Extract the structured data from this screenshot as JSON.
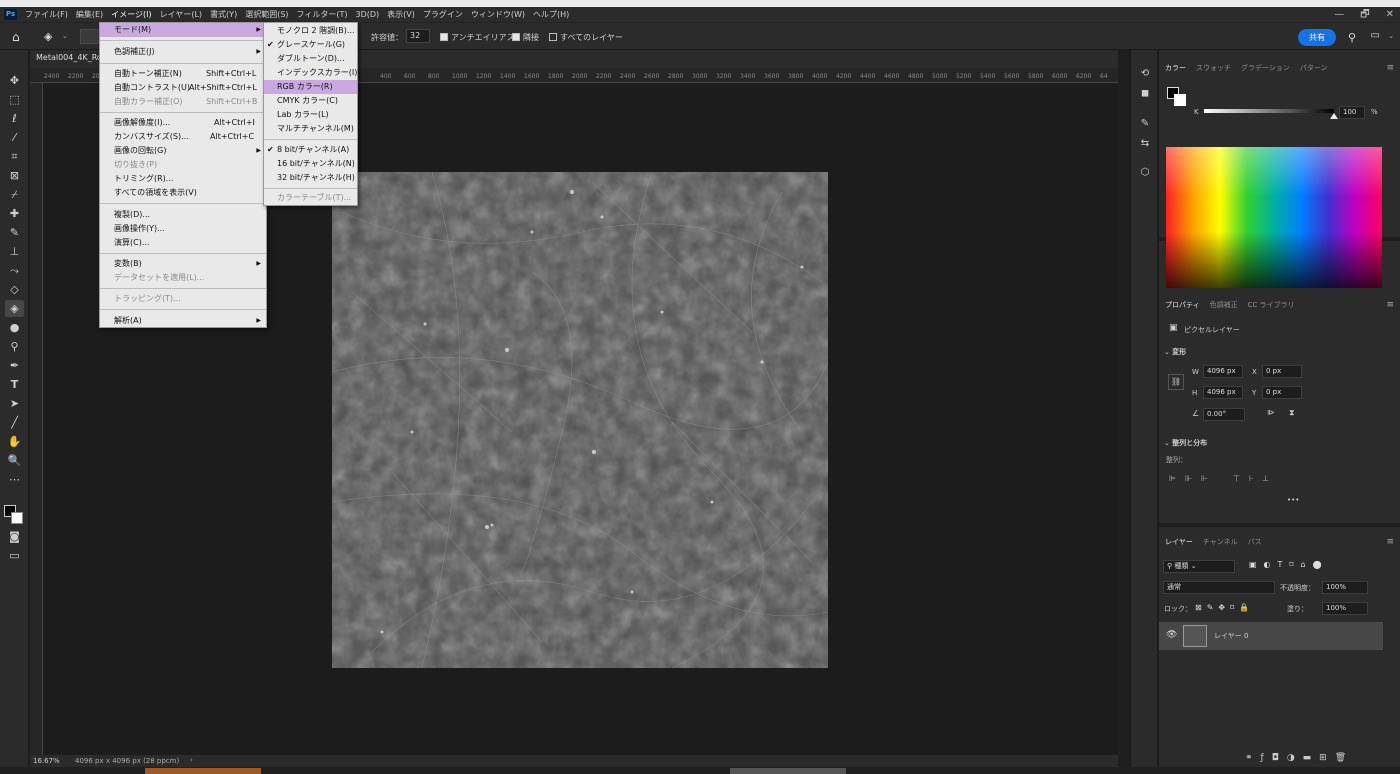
{
  "app": {
    "logo": "Ps"
  },
  "menubar": {
    "items": [
      "ファイル(F)",
      "編集(E)",
      "イメージ(I)",
      "レイヤー(L)",
      "書式(Y)",
      "選択範囲(S)",
      "フィルター(T)",
      "3D(D)",
      "表示(V)",
      "プラグイン",
      "ウィンドウ(W)",
      "ヘルプ(H)"
    ],
    "window_controls": [
      "—",
      "🗗",
      "✕"
    ]
  },
  "options": {
    "tolerance_label": "許容値：",
    "tolerance_value": "32",
    "antialias_label": "アンチエイリアス",
    "contiguous_label": "隣接",
    "all_layers_label": "すべてのレイヤー",
    "share_label": "共有"
  },
  "document": {
    "tab_label": "Metal004_4K_Ro",
    "ruler_ticks": [
      "2400",
      "2200",
      "200",
      "400",
      "600",
      "800",
      "1000",
      "1200",
      "1400",
      "1600",
      "1800",
      "2000",
      "2200",
      "2400",
      "2600",
      "2800",
      "3000",
      "3200",
      "3400",
      "3600",
      "3800",
      "4000",
      "4200",
      "4400",
      "4600",
      "4800",
      "5000",
      "5200",
      "5400",
      "5600",
      "5800",
      "6000",
      "6200",
      "64"
    ]
  },
  "status": {
    "zoom": "16.67%",
    "info": "4096 px x 4096 px (28 ppcm)"
  },
  "image_menu": {
    "items": [
      {
        "label": "モード(M)",
        "shortcut": "",
        "submenu": true,
        "highlight": true
      },
      {
        "label": "色調補正(J)",
        "shortcut": "",
        "submenu": true
      },
      {
        "label": "自動トーン補正(N)",
        "shortcut": "Shift+Ctrl+L"
      },
      {
        "label": "自動コントラスト(U)",
        "shortcut": "Alt+Shift+Ctrl+L"
      },
      {
        "label": "自動カラー補正(O)",
        "shortcut": "Shift+Ctrl+B",
        "disabled": true
      },
      {
        "label": "画像解像度(I)...",
        "shortcut": "Alt+Ctrl+I"
      },
      {
        "label": "カンバスサイズ(S)...",
        "shortcut": "Alt+Ctrl+C"
      },
      {
        "label": "画像の回転(G)",
        "shortcut": "",
        "submenu": true
      },
      {
        "label": "切り抜き(P)",
        "shortcut": "",
        "disabled": true
      },
      {
        "label": "トリミング(R)...",
        "shortcut": ""
      },
      {
        "label": "すべての領域を表示(V)",
        "shortcut": ""
      },
      {
        "label": "複製(D)...",
        "shortcut": ""
      },
      {
        "label": "画像操作(Y)...",
        "shortcut": ""
      },
      {
        "label": "演算(C)...",
        "shortcut": ""
      },
      {
        "label": "変数(B)",
        "shortcut": "",
        "submenu": true
      },
      {
        "label": "データセットを適用(L)...",
        "shortcut": "",
        "disabled": true
      },
      {
        "label": "トラッピング(T)...",
        "shortcut": "",
        "disabled": true
      },
      {
        "label": "解析(A)",
        "shortcut": "",
        "submenu": true
      }
    ]
  },
  "mode_menu": {
    "items": [
      {
        "label": "モノクロ 2 階調(B)...",
        "checked": false
      },
      {
        "label": "グレースケール(G)",
        "checked": true
      },
      {
        "label": "ダブルトーン(D)...",
        "checked": false
      },
      {
        "label": "インデックスカラー(I)",
        "checked": false
      },
      {
        "label": "RGB カラー(R)",
        "checked": false,
        "highlight": true
      },
      {
        "label": "CMYK カラー(C)",
        "checked": false
      },
      {
        "label": "Lab カラー(L)",
        "checked": false
      },
      {
        "label": "マルチチャンネル(M)",
        "checked": false
      },
      {
        "label": "8 bit/チャンネル(A)",
        "checked": true
      },
      {
        "label": "16 bit/チャンネル(N)",
        "checked": false
      },
      {
        "label": "32 bit/チャンネル(H)",
        "checked": false
      },
      {
        "label": "カラーテーブル(T)...",
        "checked": false,
        "disabled": true
      }
    ]
  },
  "color_panel": {
    "tabs": [
      "カラー",
      "スウォッチ",
      "グラデーション",
      "パターン"
    ],
    "channel": "K",
    "value": "100",
    "unit": "%",
    "slider_level": 1.0
  },
  "properties_panel": {
    "tabs": [
      "プロパティ",
      "色調補正",
      "CC ライブラリ"
    ],
    "layer_type": "ピクセルレイヤー",
    "transform_title": "変形",
    "w_label": "W",
    "w": "4096 px",
    "x_label": "X",
    "x": "0 px",
    "h_label": "H",
    "h": "4096 px",
    "y_label": "Y",
    "y": "0 px",
    "angle": "0.00°",
    "align_title": "整列と分布",
    "align_label": "整列：",
    "more": "•••"
  },
  "layers_panel": {
    "tabs": [
      "レイヤー",
      "チャンネル",
      "パス"
    ],
    "filter": "種類",
    "blend": "通常",
    "opacity_label": "不透明度：",
    "opacity": "100%",
    "lock_label": "ロック：",
    "fill_label": "塗り：",
    "fill": "100%",
    "layer_name": "レイヤー 0"
  }
}
